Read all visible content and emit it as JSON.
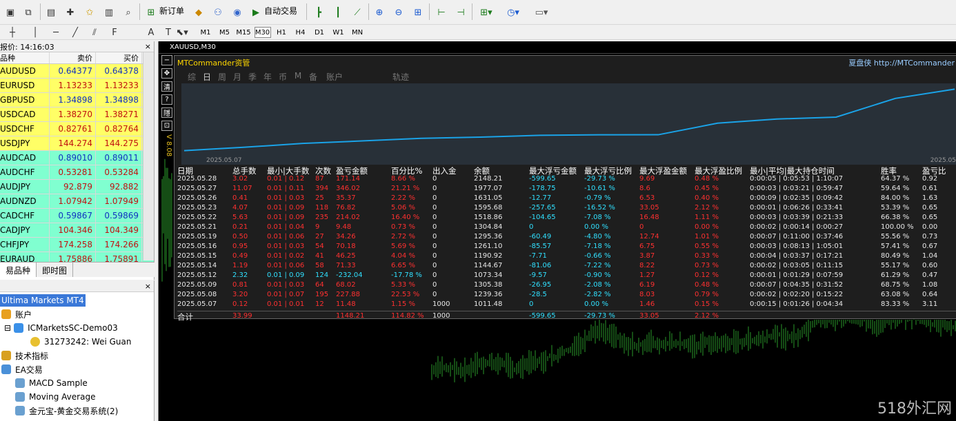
{
  "toolbar": {
    "new_order": "新订单",
    "auto_trade": "自动交易"
  },
  "timeframes": [
    "M1",
    "M5",
    "M15",
    "M30",
    "H1",
    "H4",
    "D1",
    "W1",
    "MN"
  ],
  "active_tf": "M30",
  "market_watch": {
    "title": "报价: 14:16:03",
    "col_symbol": "品种",
    "col_bid": "卖价",
    "col_ask": "买价",
    "rows": [
      {
        "sym": "AUDUSD",
        "bid": "0.64377",
        "ask": "0.64378",
        "bg": "#ffff66"
      },
      {
        "sym": "EURUSD",
        "bid": "1.13233",
        "ask": "1.13233",
        "bg": "#ffff66"
      },
      {
        "sym": "GBPUSD",
        "bid": "1.34898",
        "ask": "1.34898",
        "bg": "#ffff66"
      },
      {
        "sym": "USDCAD",
        "bid": "1.38270",
        "ask": "1.38271",
        "bg": "#ffff66"
      },
      {
        "sym": "USDCHF",
        "bid": "0.82761",
        "ask": "0.82764",
        "bg": "#ffff66"
      },
      {
        "sym": "USDJPY",
        "bid": "144.274",
        "ask": "144.275",
        "bg": "#ffff66"
      },
      {
        "sym": "AUDCAD",
        "bid": "0.89010",
        "ask": "0.89011",
        "bg": "#80ffd0"
      },
      {
        "sym": "AUDCHF",
        "bid": "0.53281",
        "ask": "0.53284",
        "bg": "#80ffd0"
      },
      {
        "sym": "AUDJPY",
        "bid": "92.879",
        "ask": "92.882",
        "bg": "#80ffd0"
      },
      {
        "sym": "AUDNZD",
        "bid": "1.07942",
        "ask": "1.07949",
        "bg": "#80ffd0"
      },
      {
        "sym": "CADCHF",
        "bid": "0.59867",
        "ask": "0.59869",
        "bg": "#80ffd0"
      },
      {
        "sym": "CADJPY",
        "bid": "104.346",
        "ask": "104.349",
        "bg": "#80ffd0"
      },
      {
        "sym": "CHFJPY",
        "bid": "174.258",
        "ask": "174.266",
        "bg": "#80ffd0"
      },
      {
        "sym": "EURAUD",
        "bid": "1.75886",
        "ask": "1.75891",
        "bg": "#80ffd0"
      }
    ],
    "tab1": "易品种",
    "tab2": "即时图"
  },
  "navigator": {
    "root": "Ultima Markets MT4",
    "accounts": "账户",
    "server": "ICMarketsSC-Demo03",
    "account": "31273242: Wei Guan",
    "indicators": "技术指标",
    "ea": "EA交易",
    "ea1": "MACD Sample",
    "ea2": "Moving Average",
    "ea3": "金元宝-黄金交易系统(2)"
  },
  "chart": {
    "title": "XAUUSD,M30",
    "side_label": "V 8.08"
  },
  "mtc": {
    "title": "MTCommander资管",
    "right": "夏盘侠  http://MTCommander",
    "tabs": [
      "综",
      "日",
      "周",
      "月",
      "季",
      "年",
      "币",
      "M",
      "备",
      "账户"
    ],
    "tab_extra": "轨迹",
    "active_tab": "日",
    "eq_start_label": "2025.05.07",
    "eq_end_label": "2025.05",
    "equity": [
      1011.48,
      1073.34,
      1144.67,
      1190.92,
      1239.36,
      1261.1,
      1295.36,
      1304.84,
      1305.38,
      1518.86,
      1595.68,
      1631.05,
      1977.07,
      2148.21
    ],
    "headers": [
      "日期",
      "总手数",
      "最小|大手数",
      "次数",
      "盈亏金额",
      "百分比%",
      "出入金",
      "余额",
      "最大浮亏金额",
      "最大浮亏比例",
      "最大浮盈金额",
      "最大浮盈比例",
      "最小|平均|最大持仓时间",
      "胜率",
      "盈亏比"
    ],
    "rows": [
      [
        "2025.05.28",
        "3.02",
        "0.01 | 0.12",
        "87",
        "171.14",
        "8.66 %",
        "0",
        "2148.21",
        "-599.65",
        "-29.73 %",
        "9.69",
        "0.48 %",
        "0:00:05 | 0:05:53 | 1:10:07",
        "64.37 %",
        "0.92"
      ],
      [
        "2025.05.27",
        "11.07",
        "0.01 | 0.11",
        "394",
        "346.02",
        "21.21 %",
        "0",
        "1977.07",
        "-178.75",
        "-10.61 %",
        "8.6",
        "0.45 %",
        "0:00:03 | 0:03:21 | 0:59:47",
        "59.64 %",
        "0.61"
      ],
      [
        "2025.05.26",
        "0.41",
        "0.01 | 0.03",
        "25",
        "35.37",
        "2.22 %",
        "0",
        "1631.05",
        "-12.77",
        "-0.79 %",
        "6.53",
        "0.40 %",
        "0:00:09 | 0:02:35 | 0:09:42",
        "84.00 %",
        "1.63"
      ],
      [
        "2025.05.23",
        "4.07",
        "0.01 | 0.09",
        "118",
        "76.82",
        "5.06 %",
        "0",
        "1595.68",
        "-257.65",
        "-16.52 %",
        "33.05",
        "2.12 %",
        "0:00:01 | 0:06:26 | 0:33:41",
        "53.39 %",
        "0.65"
      ],
      [
        "2025.05.22",
        "5.63",
        "0.01 | 0.09",
        "235",
        "214.02",
        "16.40 %",
        "0",
        "1518.86",
        "-104.65",
        "-7.08 %",
        "16.48",
        "1.11 %",
        "0:00:03 | 0:03:39 | 0:21:33",
        "66.38 %",
        "0.65"
      ],
      [
        "2025.05.21",
        "0.21",
        "0.01 | 0.04",
        "9",
        "9.48",
        "0.73 %",
        "0",
        "1304.84",
        "0",
        "0.00 %",
        "0",
        "0.00 %",
        "0:00:02 | 0:00:14 | 0:00:27",
        "100.00 %",
        "0.00"
      ],
      [
        "2025.05.19",
        "0.50",
        "0.01 | 0.06",
        "27",
        "34.26",
        "2.72 %",
        "0",
        "1295.36",
        "-60.49",
        "-4.80 %",
        "12.74",
        "1.01 %",
        "0:00:07 | 0:11:00 | 0:37:46",
        "55.56 %",
        "0.73"
      ],
      [
        "2025.05.16",
        "0.95",
        "0.01 | 0.03",
        "54",
        "70.18",
        "5.69 %",
        "0",
        "1261.10",
        "-85.57",
        "-7.18 %",
        "6.75",
        "0.55 %",
        "0:00:03 | 0:08:13 | 1:05:01",
        "57.41 %",
        "0.67"
      ],
      [
        "2025.05.15",
        "0.49",
        "0.01 | 0.02",
        "41",
        "46.25",
        "4.04 %",
        "0",
        "1190.92",
        "-7.71",
        "-0.66 %",
        "3.87",
        "0.33 %",
        "0:00:04 | 0:03:37 | 0:17:21",
        "80.49 %",
        "1.04"
      ],
      [
        "2025.05.14",
        "1.19",
        "0.01 | 0.06",
        "58",
        "71.33",
        "6.65 %",
        "0",
        "1144.67",
        "-81.06",
        "-7.22 %",
        "8.22",
        "0.73 %",
        "0:00:02 | 0:03:05 | 0:11:15",
        "55.17 %",
        "0.60"
      ],
      [
        "2025.05.12",
        "2.32",
        "0.01 | 0.09",
        "124",
        "-232.04",
        "-17.78 %",
        "0",
        "1073.34",
        "-9.57",
        "-0.90 %",
        "1.27",
        "0.12 %",
        "0:00:01 | 0:01:29 | 0:07:59",
        "61.29 %",
        "0.47"
      ],
      [
        "2025.05.09",
        "0.81",
        "0.01 | 0.03",
        "64",
        "68.02",
        "5.33 %",
        "0",
        "1305.38",
        "-26.95",
        "-2.08 %",
        "6.19",
        "0.48 %",
        "0:00:07 | 0:04:35 | 0:31:52",
        "68.75 %",
        "1.08"
      ],
      [
        "2025.05.08",
        "3.20",
        "0.01 | 0.07",
        "195",
        "227.88",
        "22.53 %",
        "0",
        "1239.36",
        "-28.5",
        "-2.82 %",
        "8.03",
        "0.79 %",
        "0:00:02 | 0:02:20 | 0:15:22",
        "63.08 %",
        "0.64"
      ],
      [
        "2025.05.07",
        "0.12",
        "0.01 | 0.01",
        "12",
        "11.48",
        "1.15 %",
        "1000",
        "1011.48",
        "0",
        "0.00 %",
        "1.46",
        "0.15 %",
        "0:00:15 | 0:01:26 | 0:04:34",
        "83.33 %",
        "3.11"
      ]
    ],
    "footer": [
      "合计",
      "33.99",
      "",
      "",
      "1148.21",
      "114.82 %",
      "1000",
      "",
      "-599.65",
      "-29.73 %",
      "33.05",
      "2.12 %",
      "",
      "",
      ""
    ]
  },
  "watermark": "518外汇网",
  "colors": {
    "red": "#ff3030",
    "cyan": "#30e0ff",
    "white": "#e8e8e8",
    "green": "#2a9a2a",
    "line": "#1aa3e8"
  }
}
